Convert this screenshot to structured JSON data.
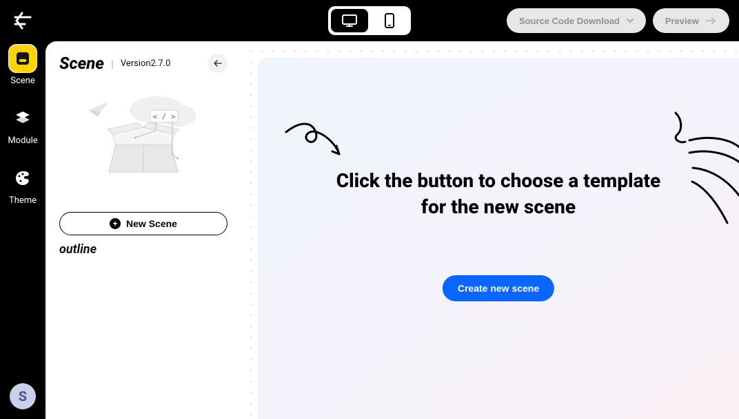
{
  "topbar": {
    "source_code_label": "Source Code Download",
    "preview_label": "Preview"
  },
  "rail": {
    "items": [
      {
        "label": "Scene",
        "icon": "scene-icon"
      },
      {
        "label": "Module",
        "icon": "module-icon"
      },
      {
        "label": "Theme",
        "icon": "theme-icon"
      }
    ],
    "avatar_letter": "S"
  },
  "sidepanel": {
    "title": "Scene",
    "version_prefix": "Version",
    "version": "2.7.0",
    "new_scene_label": "New Scene",
    "outline_label": "outline"
  },
  "canvas": {
    "hero_line1": "Click the button to choose a template",
    "hero_line2": "for the new scene",
    "cta_label": "Create new scene"
  }
}
